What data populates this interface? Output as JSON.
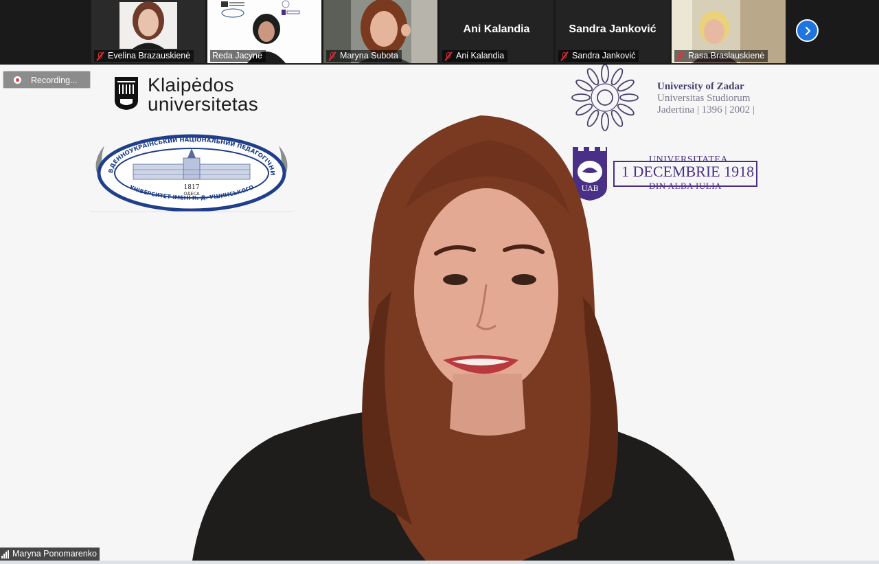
{
  "participants": [
    {
      "name": "Evelina Brazauskienė",
      "muted": true,
      "video": true
    },
    {
      "name": "Reda Jacyne",
      "muted": false,
      "video": true
    },
    {
      "name": "Maryna Subota",
      "muted": true,
      "video": true
    },
    {
      "name": "Ani Kalandia",
      "muted": true,
      "video": false,
      "display_name": "Ani Kalandia"
    },
    {
      "name": "Sandra Janković",
      "muted": true,
      "video": false,
      "display_name": "Sandra Janković"
    },
    {
      "name": "Rasa.Braslauskienė",
      "muted": true,
      "video": true
    }
  ],
  "recording": {
    "label": "Recording..."
  },
  "active_speaker": {
    "name": "Maryna Ponomarenko"
  },
  "logos": {
    "klaipeda": {
      "line1": "Klaipėdos",
      "line2": "universitetas"
    },
    "odesa": {
      "year": "1817",
      "city": "ОДЕСА",
      "top_text": "ПІВДЕННОУКРАЇНСЬКИЙ НАЦІОНАЛЬНИЙ ПЕДАГОГІЧНИЙ",
      "bottom_text": "УНІВЕРСИТЕТ ІМЕНІ К. Д. УШИНСЬКОГО"
    },
    "zadar": {
      "line1": "University of Zadar",
      "line2": "Universitas Studiorum",
      "line3": "Jadertina | 1396 | 2002 |"
    },
    "uab": {
      "line1": "UNIVERSITATEA",
      "line2": "1 DECEMBRIE 1918",
      "line3": "DIN ALBA IULIA",
      "badge": "UAB"
    }
  },
  "colors": {
    "mute_red": "#e0323b",
    "next_blue": "#1e74e0",
    "uab_purple": "#4a2f86",
    "zadar_text": "#4a3f6b",
    "odesa_blue": "#1f3f8a"
  }
}
